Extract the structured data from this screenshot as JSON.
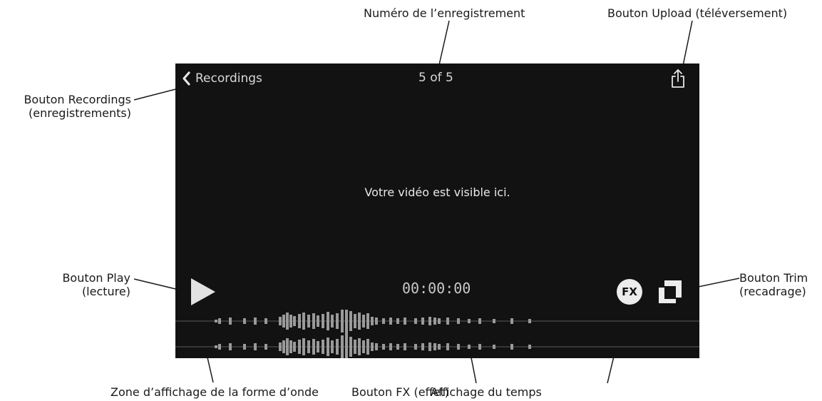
{
  "screen": {
    "back_label": "Recordings",
    "counter": "5 of 5",
    "video_message": "Votre vidéo est visible ici.",
    "time": "00:00:00",
    "fx_label": "FX",
    "icons": {
      "back": "chevron-left-icon",
      "upload": "share-upload-icon",
      "play": "play-icon",
      "trim": "trim-icon"
    }
  },
  "callouts": {
    "recording_number": "Numéro de l’enregistrement",
    "upload_button": "Bouton Upload (téléversement)",
    "recordings_button_line1": "Bouton Recordings",
    "recordings_button_line2": "(enregistrements)",
    "play_button_line1": "Bouton Play",
    "play_button_line2": "(lecture)",
    "trim_button_line1": "Bouton Trim",
    "trim_button_line2": "(recadrage)",
    "waveform_zone": "Zone d’affichage de la forme d’onde",
    "fx_button": "Bouton FX (effet)",
    "time_display": "Affichage du temps"
  },
  "colors": {
    "screen_background": "#121212",
    "ui_text": "#d8d8d8",
    "waveform": "#9a9a9a",
    "annotation_text": "#1a1a1a"
  }
}
